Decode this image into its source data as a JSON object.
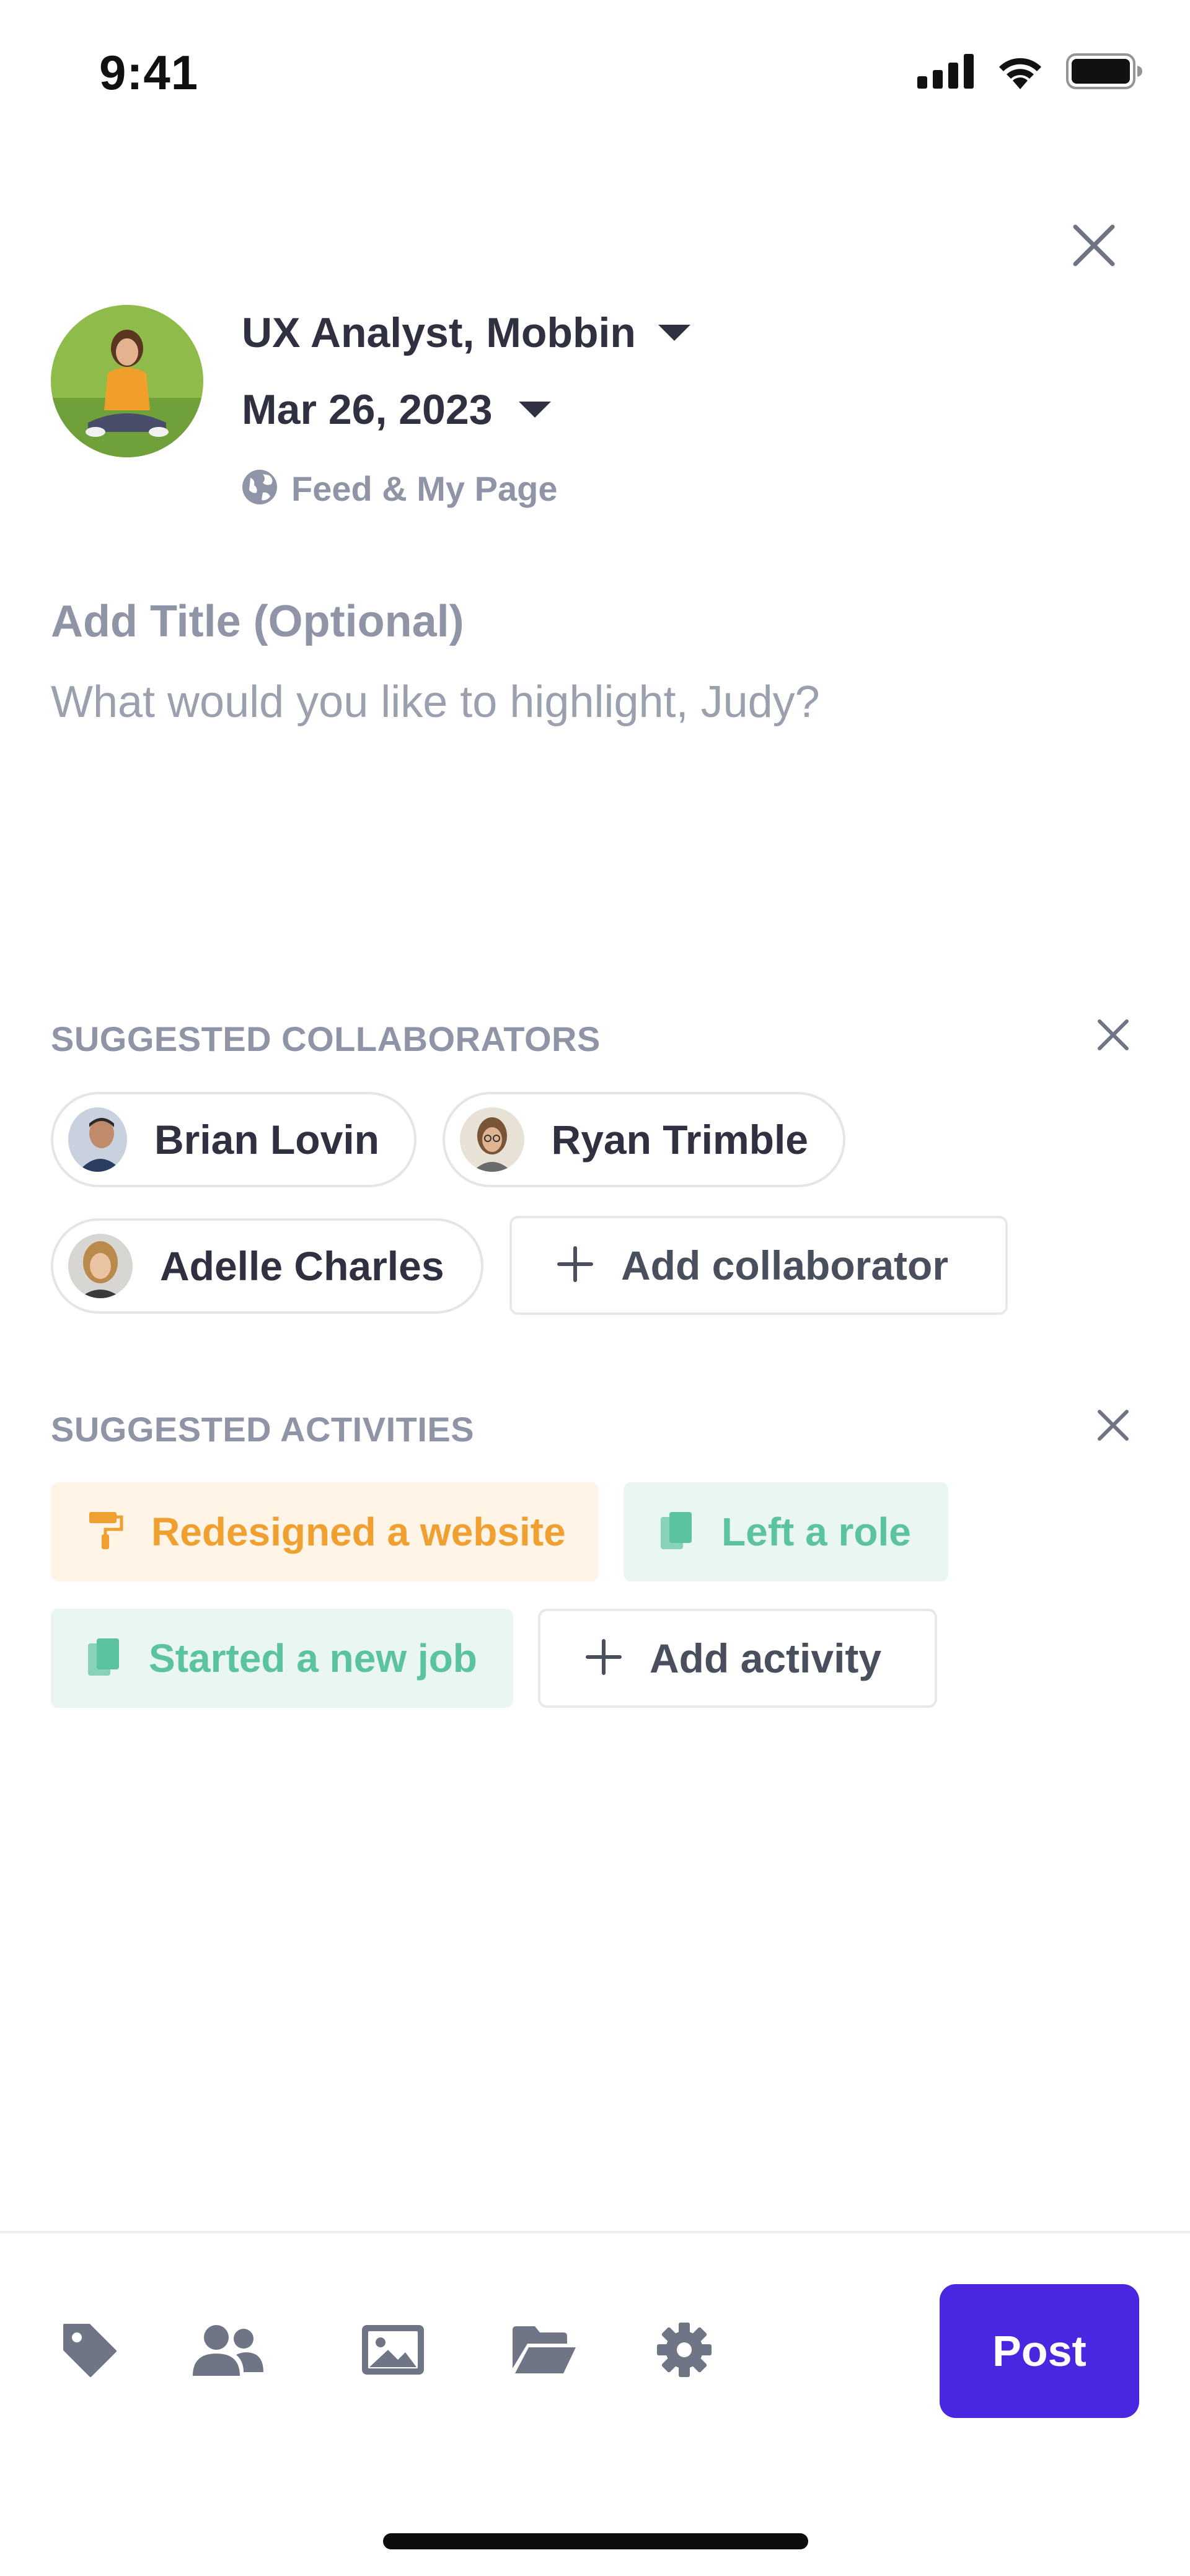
{
  "status_bar": {
    "time": "9:41",
    "icons": [
      "cellular-signal-icon",
      "wifi-icon",
      "battery-icon"
    ]
  },
  "header": {
    "close_icon": "close-icon",
    "role": "UX Analyst, Mobbin",
    "date": "Mar 26, 2023",
    "audience": "Feed & My Page",
    "audience_icon": "globe-icon"
  },
  "composer": {
    "title_placeholder": "Add Title (Optional)",
    "body_placeholder": "What would you like to highlight, Judy?"
  },
  "collaborators": {
    "label": "SUGGESTED COLLABORATORS",
    "items": [
      {
        "name": "Brian Lovin"
      },
      {
        "name": "Ryan Trimble"
      },
      {
        "name": "Adelle Charles"
      }
    ],
    "add_label": "Add collaborator"
  },
  "activities": {
    "label": "SUGGESTED ACTIVITIES",
    "items": [
      {
        "label": "Redesigned a website",
        "icon": "paint-roller-icon",
        "color": "#f0a030",
        "bg": "#fff4e6"
      },
      {
        "label": "Left a role",
        "icon": "document-icon",
        "color": "#5cc3a0",
        "bg": "#e9f6f2"
      },
      {
        "label": "Started a new job",
        "icon": "document-icon",
        "color": "#5cc3a0",
        "bg": "#e9f6f2"
      }
    ],
    "add_label": "Add activity"
  },
  "toolbar": {
    "tools": [
      "tag-icon",
      "people-icon",
      "image-icon",
      "folder-icon",
      "settings-icon"
    ],
    "post_label": "Post",
    "post_color": "#4a26e1"
  }
}
